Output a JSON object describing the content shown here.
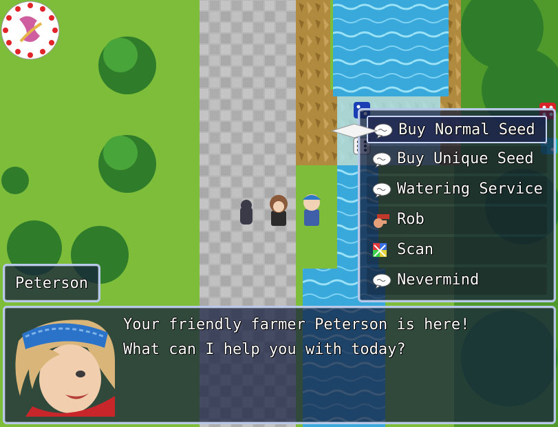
{
  "speaker": {
    "name": "Peterson"
  },
  "message": {
    "lines": [
      "Your friendly farmer Peterson is here!",
      "What can I help you with today?"
    ]
  },
  "choices": [
    {
      "label": "Buy Normal Seed",
      "icon": "speech-bubble-icon",
      "selected": true
    },
    {
      "label": "Buy Unique Seed",
      "icon": "speech-bubble-icon",
      "selected": false
    },
    {
      "label": "Watering Service",
      "icon": "speech-bubble-icon",
      "selected": false
    },
    {
      "label": "Rob",
      "icon": "hand-grab-icon",
      "selected": false
    },
    {
      "label": "Scan",
      "icon": "prism-icon",
      "selected": false
    },
    {
      "label": "Nevermind",
      "icon": "speech-bubble-icon",
      "selected": false
    }
  ],
  "colors": {
    "grass": "#7dbd3a",
    "path": "#b4b4b4",
    "water": "#3aa6d8",
    "window": "#141c3c",
    "window_border": "#b8c8e8"
  }
}
